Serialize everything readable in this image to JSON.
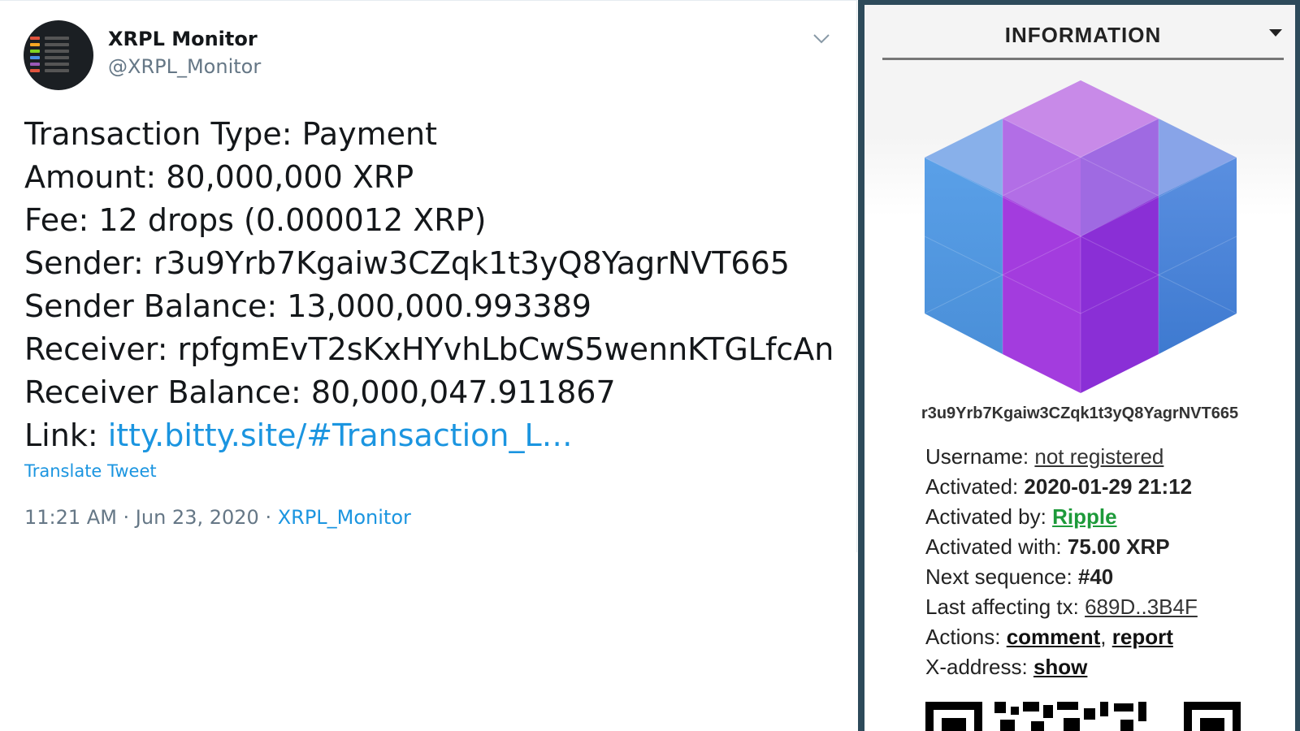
{
  "tweet": {
    "display_name": "XRPL Monitor",
    "handle": "@XRPL_Monitor",
    "lines": [
      "Transaction Type: Payment",
      "Amount: 80,000,000 XRP",
      "Fee: 12 drops (0.000012 XRP)",
      "Sender: r3u9Yrb7Kgaiw3CZqk1t3yQ8YagrNVT665",
      "Sender Balance: 13,000,000.993389",
      "Receiver: rpfgmEvT2sKxHYvhLbCwS5wennKTGLfcAn",
      "Receiver Balance: 80,000,047.911867"
    ],
    "link_label": "Link: ",
    "link_text": "itty.bitty.site/#Transaction_L…",
    "translate": "Translate Tweet",
    "timestamp": "11:21 AM · Jun 23, 2020 · ",
    "source": "XRPL_Monitor",
    "icons": {
      "menu": "chevron-down-icon"
    },
    "colors": {
      "link": "#1b95e0",
      "muted": "#657786",
      "text": "#14171a"
    }
  },
  "panel": {
    "title": "INFORMATION",
    "address": "r3u9Yrb7Kgaiw3CZqk1t3yQ8YagrNVT665",
    "username_label": "Username: ",
    "username_value": "not registered",
    "activated_label": "Activated: ",
    "activated_value": "2020-01-29 21:12",
    "activated_by_label": "Activated by: ",
    "activated_by_value": "Ripple",
    "activated_with_label": "Activated with: ",
    "activated_with_value": "75.00 XRP",
    "next_seq_label": "Next sequence: ",
    "next_seq_value": "#40",
    "last_tx_label": "Last affecting tx: ",
    "last_tx_value": "689D..3B4F",
    "actions_label": "Actions: ",
    "action_comment": "comment",
    "action_sep": ", ",
    "action_report": "report",
    "xaddress_label": "X-address: ",
    "xaddress_value": "show",
    "colors": {
      "frame": "#2d4a5a",
      "green": "#1d9a3a"
    },
    "icons": {
      "avatar": "identicon-cube",
      "qr": "qr-code"
    }
  }
}
